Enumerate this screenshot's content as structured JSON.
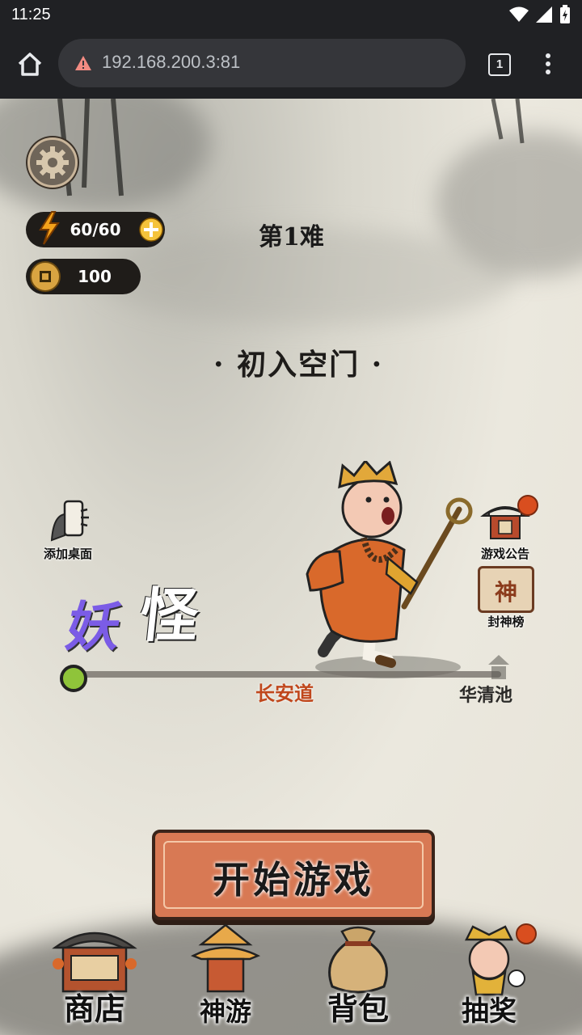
{
  "status_bar": {
    "time": "11:25"
  },
  "browser": {
    "url": "192.168.200.3:81",
    "tab_count": "1"
  },
  "hud": {
    "energy": "60/60",
    "coins": "100"
  },
  "level": {
    "stage": "第1难",
    "name": "· 初入空门 ·"
  },
  "side_left": {
    "add_desktop": "添加桌面"
  },
  "side_right": {
    "announcement": "游戏公告",
    "fengshen": "封神榜",
    "fengshen_glyph": "神"
  },
  "monster_label": {
    "first": "妖",
    "second": "怪"
  },
  "route": {
    "current": "长安道",
    "next": "华清池"
  },
  "start_button": "开始游戏",
  "nav": [
    {
      "label": "商店"
    },
    {
      "label": "神游"
    },
    {
      "label": "背包"
    },
    {
      "label": "抽奖"
    }
  ],
  "colors": {
    "accent": "#d87954",
    "current_location": "#c0471c",
    "monster_purple": "#7b5ce6"
  }
}
